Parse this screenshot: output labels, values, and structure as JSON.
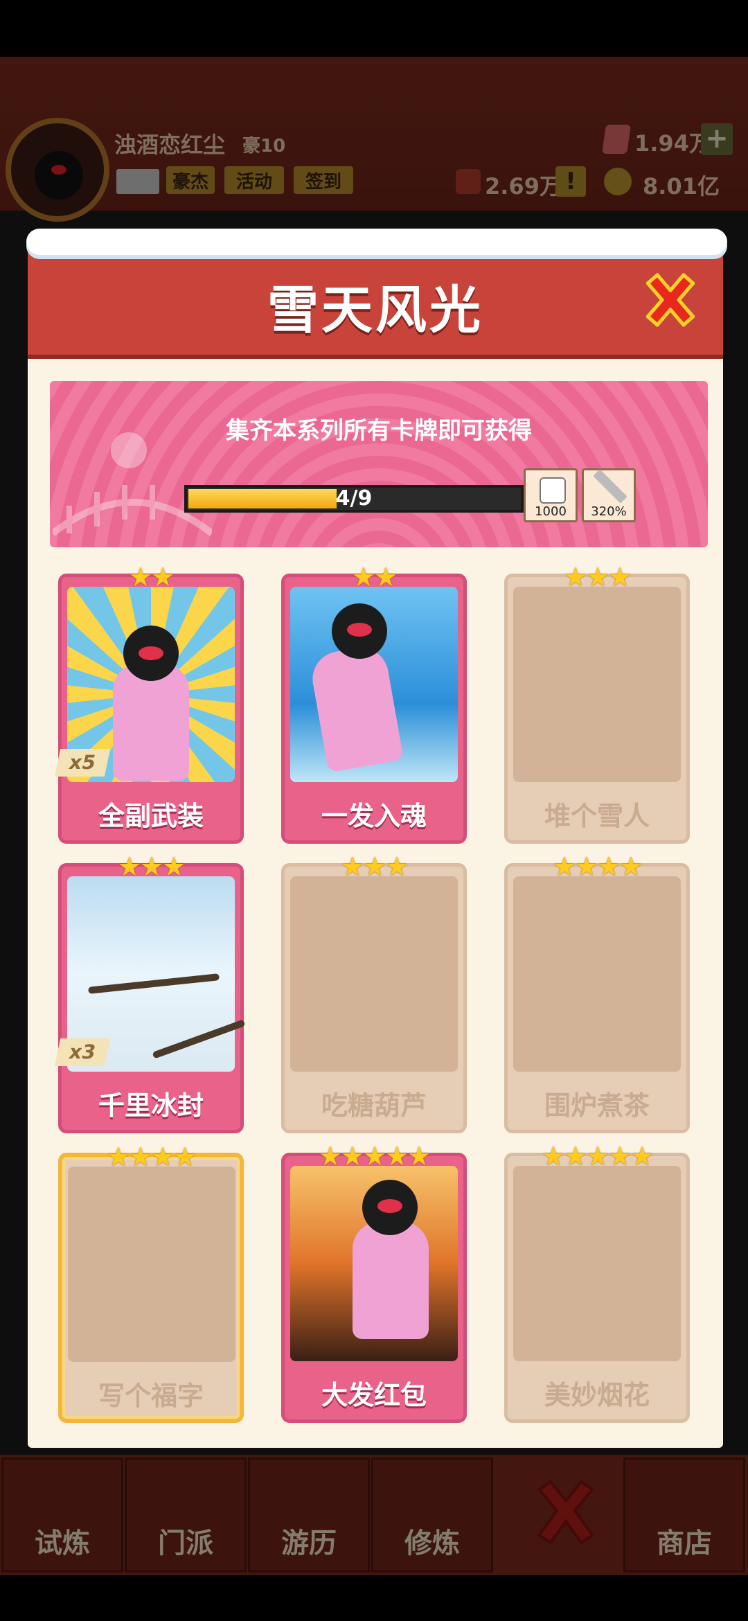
{
  "hud": {
    "username": "浊酒恋红尘",
    "rank": "豪10",
    "buttons": [
      "豪杰",
      "活动",
      "签到"
    ],
    "gems": "1.94万",
    "tokens": "2.69万",
    "gold": "8.01亿"
  },
  "modal": {
    "title": "雪天风光",
    "subtitle": "集齐本系列所有卡牌即可获得",
    "progress": {
      "current": 4,
      "total": 9,
      "text": "4/9"
    },
    "rewards": [
      {
        "icon": "dice-icon",
        "value": "1000"
      },
      {
        "icon": "sword-icon",
        "value": "320%"
      }
    ]
  },
  "cards": [
    {
      "name": "全副武装",
      "stars": "★★",
      "owned": true,
      "count": "x5"
    },
    {
      "name": "一发入魂",
      "stars": "★★",
      "owned": true,
      "count": ""
    },
    {
      "name": "堆个雪人",
      "stars": "★★★",
      "owned": false,
      "count": ""
    },
    {
      "name": "千里冰封",
      "stars": "★★★",
      "owned": true,
      "count": "x3"
    },
    {
      "name": "吃糖葫芦",
      "stars": "★★★",
      "owned": false,
      "count": ""
    },
    {
      "name": "围炉煮茶",
      "stars": "★★★★",
      "owned": false,
      "count": ""
    },
    {
      "name": "写个福字",
      "stars": "★★★★",
      "owned": false,
      "count": ""
    },
    {
      "name": "大发红包",
      "stars": "★★★★★",
      "owned": true,
      "count": ""
    },
    {
      "name": "美妙烟花",
      "stars": "★★★★★",
      "owned": false,
      "count": ""
    }
  ],
  "nav": [
    "试炼",
    "门派",
    "游历",
    "修炼",
    "",
    "商店"
  ],
  "colors": {
    "accent": "#c8433a",
    "card_owned": "#e9628a",
    "card_locked": "#e6cdb6",
    "star": "#ffcb1f"
  }
}
